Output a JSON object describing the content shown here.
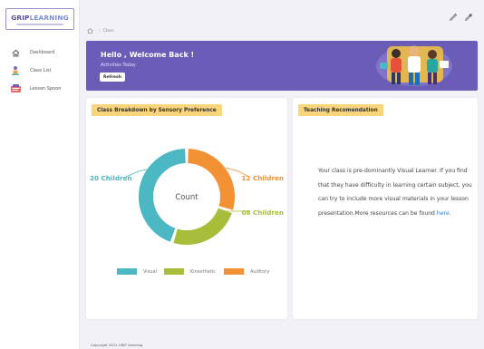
{
  "logo": {
    "part1": "GRIP",
    "part2": "LEARNING"
  },
  "sidebar": {
    "items": [
      {
        "label": "Dashboard",
        "icon": "home-icon"
      },
      {
        "label": "Class List",
        "icon": "class-list-icon"
      },
      {
        "label": "Lesson Spoon",
        "icon": "lesson-icon"
      }
    ]
  },
  "breadcrumb": {
    "current": "Class"
  },
  "topbar": {
    "icons": [
      "edit-icon",
      "settings-icon"
    ]
  },
  "banner": {
    "title": "Hello , Welcome Back !",
    "subtitle": "Activities Today",
    "refresh_label": "Refresh"
  },
  "breakdown_card": {
    "title": "Class Breakdown by Sensory Preference"
  },
  "chart_data": {
    "type": "pie",
    "center_label": "Count",
    "categories": [
      "Visual",
      "Kinesthetic",
      "Auditory"
    ],
    "values": [
      20,
      8,
      12
    ],
    "data_labels": [
      "20 Children",
      "08 Children",
      "12 Children"
    ],
    "colors": [
      "#4bb8c3",
      "#a8bd3a",
      "#f39235"
    ],
    "legend_position": "bottom"
  },
  "recommendation_card": {
    "title": "Teaching Recomendation",
    "text": "Your class is pre-dominantly Visual Learner. If you find that they have difficulty in learning certain subject, you can try to include more visual materials in your lesson presentation.More resources can be found ",
    "link_text": "here",
    "text_end": "."
  },
  "footer": {
    "text": "Copyright 2021 GRIP Learning"
  },
  "colors": {
    "primary": "#6b5cb8",
    "header_yellow": "#fad57a",
    "background": "#f2f1f7"
  }
}
